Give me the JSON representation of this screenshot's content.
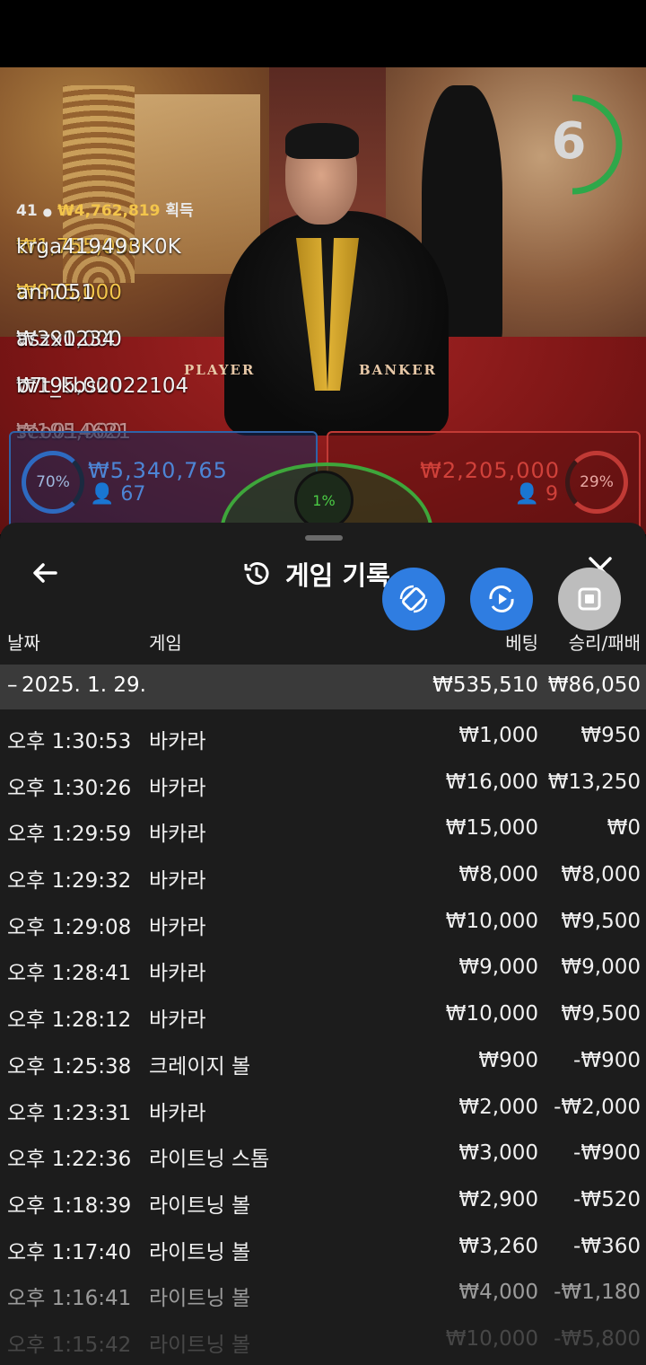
{
  "overlay": {
    "round_count": "41",
    "total_won": "₩4,762,819",
    "won_label": "획득",
    "winners": [
      {
        "amount": "₩1,755,000",
        "name": "krga419493K0K"
      },
      {
        "amount": "₩975,000",
        "name": "ann051"
      },
      {
        "amount": "₩390,000",
        "name": "aszx1234"
      },
      {
        "amount": "₩195,000",
        "name": "b7t_kbs2022104"
      },
      {
        "amount": "₩195,000",
        "name": "seo014621"
      }
    ],
    "timer": "6",
    "table_labels": {
      "player": "PLAYER",
      "banker": "BANKER"
    }
  },
  "bets": {
    "player": {
      "percent": "70%",
      "amount": "₩5,340,765",
      "players": "67"
    },
    "banker": {
      "percent": "29%",
      "amount": "₩2,205,000",
      "players": "9"
    },
    "tie": {
      "percent": "1%"
    }
  },
  "colors": {
    "player": "#4d85d5",
    "banker": "#d0413a",
    "tie": "#3ea63b",
    "fab": "#2f7de1",
    "gold": "#f3c54b"
  },
  "sheet": {
    "title": "게임 기록",
    "icons": {
      "back": "arrow-left-icon",
      "history": "history-icon",
      "close": "close-icon"
    },
    "columns": {
      "date": "날짜",
      "game": "게임",
      "bet": "베팅",
      "result": "승리/패배"
    },
    "group": {
      "date": "2025. 1. 29.",
      "bet": "₩535,510",
      "result": "₩86,050"
    },
    "rows": [
      {
        "time": "오후 1:30:53",
        "game": "바카라",
        "bet": "₩1,000",
        "result": "₩950"
      },
      {
        "time": "오후 1:30:26",
        "game": "바카라",
        "bet": "₩16,000",
        "result": "₩13,250"
      },
      {
        "time": "오후 1:29:59",
        "game": "바카라",
        "bet": "₩15,000",
        "result": "₩0"
      },
      {
        "time": "오후 1:29:32",
        "game": "바카라",
        "bet": "₩8,000",
        "result": "₩8,000"
      },
      {
        "time": "오후 1:29:08",
        "game": "바카라",
        "bet": "₩10,000",
        "result": "₩9,500"
      },
      {
        "time": "오후 1:28:41",
        "game": "바카라",
        "bet": "₩9,000",
        "result": "₩9,000"
      },
      {
        "time": "오후 1:28:12",
        "game": "바카라",
        "bet": "₩10,000",
        "result": "₩9,500"
      },
      {
        "time": "오후 1:25:38",
        "game": "크레이지 볼",
        "bet": "₩900",
        "result": "-₩900"
      },
      {
        "time": "오후 1:23:31",
        "game": "바카라",
        "bet": "₩2,000",
        "result": "-₩2,000"
      },
      {
        "time": "오후 1:22:36",
        "game": "라이트닝 스톰",
        "bet": "₩3,000",
        "result": "-₩900"
      },
      {
        "time": "오후 1:18:39",
        "game": "라이트닝 볼",
        "bet": "₩2,900",
        "result": "-₩520"
      },
      {
        "time": "오후 1:17:40",
        "game": "라이트닝 볼",
        "bet": "₩3,260",
        "result": "-₩360"
      },
      {
        "time": "오후 1:16:41",
        "game": "라이트닝 볼",
        "bet": "₩4,000",
        "result": "-₩1,180"
      },
      {
        "time": "오후 1:15:42",
        "game": "라이트닝 볼",
        "bet": "₩10,000",
        "result": "-₩5,800"
      }
    ]
  },
  "fabs": [
    {
      "icon": "rotate-device-icon"
    },
    {
      "icon": "replay-video-icon"
    },
    {
      "icon": "stop-icon"
    }
  ]
}
